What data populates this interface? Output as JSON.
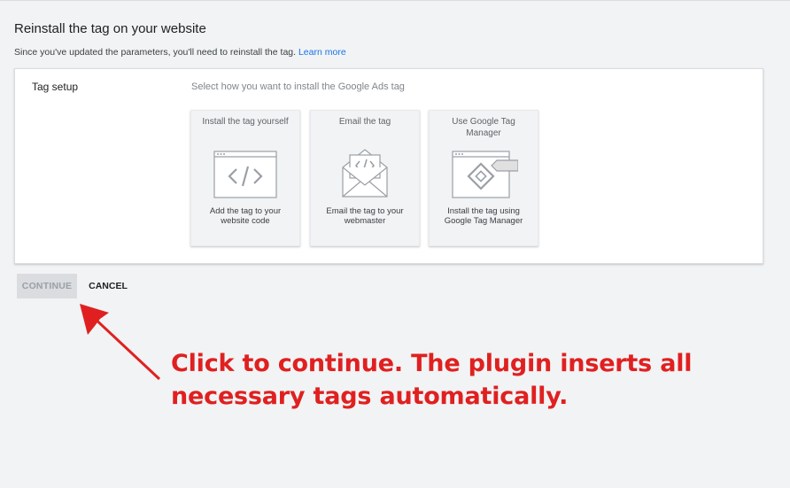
{
  "header": {
    "title": "Reinstall the tag on your website",
    "subtitle": "Since you've updated the parameters, you'll need to reinstall the tag.",
    "learn_more": "Learn more"
  },
  "panel": {
    "label": "Tag setup",
    "instruction": "Select how you want to install the Google Ads tag",
    "options": [
      {
        "title": "Install the tag yourself",
        "description": "Add the tag to your website code",
        "icon": "code-window-icon"
      },
      {
        "title": "Email the tag",
        "description": "Email the tag to your webmaster",
        "icon": "envelope-code-icon"
      },
      {
        "title": "Use Google Tag Manager",
        "description": "Install the tag using Google Tag Manager",
        "icon": "tag-manager-icon"
      }
    ]
  },
  "actions": {
    "continue_label": "CONTINUE",
    "cancel_label": "CANCEL"
  },
  "annotation": {
    "text": "Click to continue. The plugin inserts all necessary tags automatically.",
    "color": "#e02020"
  }
}
